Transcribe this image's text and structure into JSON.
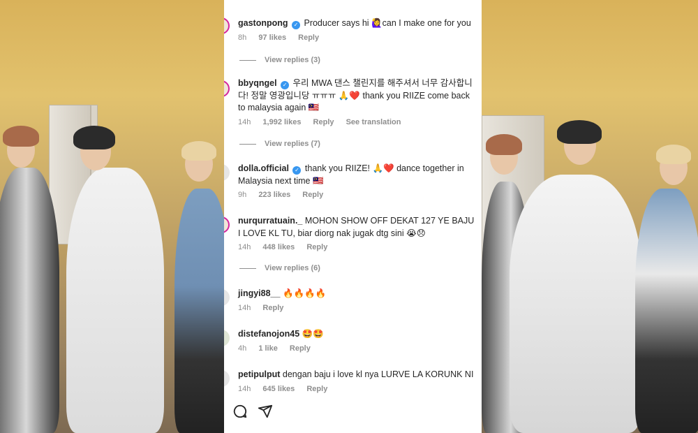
{
  "comments": [
    {
      "username": "gastonpong",
      "verified": true,
      "text": "Producer says hi 🙋‍♀️can I make one for you",
      "time": "8h",
      "likes": "97 likes",
      "reply_label": "Reply",
      "translation": "",
      "view_replies": "View replies (3)"
    },
    {
      "username": "bbyqngel",
      "verified": true,
      "text": "우리 MWA 댄스 챌린지를 해주셔서 너무 감사합니다! 정말 영광입니당 ㅠㅠㅠ 🙏❤️ thank you RIIZE come back to malaysia again 🇲🇾",
      "time": "14h",
      "likes": "1,992 likes",
      "reply_label": "Reply",
      "translation": "See translation",
      "view_replies": "View replies (7)"
    },
    {
      "username": "dolla.official",
      "verified": true,
      "text": "thank you RIIZE! 🙏❤️ dance together in Malaysia next time 🇲🇾",
      "time": "9h",
      "likes": "223 likes",
      "reply_label": "Reply",
      "translation": "",
      "view_replies": ""
    },
    {
      "username": "nurqurratuain._",
      "verified": false,
      "text": "MOHON SHOW OFF DEKAT 127 YE BAJU I LOVE KL TU, biar diorg nak jugak dtg sini 😭😞",
      "time": "14h",
      "likes": "448 likes",
      "reply_label": "Reply",
      "translation": "",
      "view_replies": "View replies (6)"
    },
    {
      "username": "jingyi88__",
      "verified": false,
      "text": "🔥🔥🔥🔥",
      "time": "14h",
      "likes": "",
      "reply_label": "Reply",
      "translation": "",
      "view_replies": ""
    },
    {
      "username": "distefanojon45",
      "verified": false,
      "text": "🤩🤩",
      "time": "4h",
      "likes": "1 like",
      "reply_label": "Reply",
      "translation": "",
      "view_replies": ""
    },
    {
      "username": "petipulput",
      "verified": false,
      "text": "dengan baju i love kl nya LURVE LA KORUNK NI",
      "time": "14h",
      "likes": "645 likes",
      "reply_label": "Reply",
      "translation": "",
      "view_replies": ""
    }
  ],
  "actions": {
    "comment_icon": "comment-icon",
    "share_icon": "send-icon"
  },
  "colors": {
    "verified": "#3897f0",
    "muted": "#8e8e8e",
    "text": "#262626"
  }
}
